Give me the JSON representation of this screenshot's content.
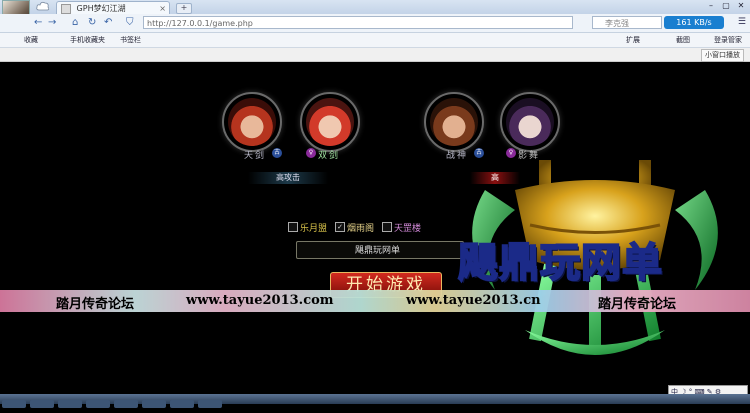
{
  "browser": {
    "tab_title": "GPH梦幻江湖",
    "tab_close": "×",
    "new_tab": "+",
    "address": "http://127.0.0.1/game.php",
    "search_text": "李克强",
    "speed": "161 KB/s",
    "window_controls": [
      "–",
      "▢",
      "✕"
    ],
    "nav_icons": [
      "←",
      "→",
      "⌂",
      "↻",
      "↶",
      "⛉"
    ]
  },
  "bookmarks": {
    "items": [
      "收藏",
      "手机收藏夹",
      "书签栏"
    ],
    "extensions": "扩展",
    "screenshot": "截图",
    "login": "登录管家"
  },
  "subbar": {
    "small_window": "小窗口播放"
  },
  "game": {
    "characters": [
      {
        "name": "天剑",
        "badge": "古"
      },
      {
        "name": "双剑",
        "badge": "♀"
      },
      {
        "name": "战神",
        "badge": "古"
      },
      {
        "name": "影舞",
        "badge": "♀"
      }
    ],
    "tag_left": "高攻击",
    "tag_right": "高",
    "servers": [
      {
        "label": "乐月盟",
        "checked": false
      },
      {
        "label": "烟雨阁",
        "checked": true
      },
      {
        "label": "天罡楼",
        "checked": false
      }
    ],
    "server_name": "飓鼎玩网单",
    "start_button": "开始游戏",
    "logo_text": "飓鼎玩网单"
  },
  "banner": {
    "left_text": "踏月传奇论坛",
    "url1": "www.tayue2013.com",
    "url2": "www.tayue2013.cn",
    "right_text": "踏月传奇论坛"
  },
  "ime": {
    "text": "中 ☽ ° ⌨ ✎ ⚙"
  },
  "colors": {
    "logo_gold": "#d8a21c",
    "logo_green": "#27c04a",
    "start_red": "#b81f16"
  }
}
